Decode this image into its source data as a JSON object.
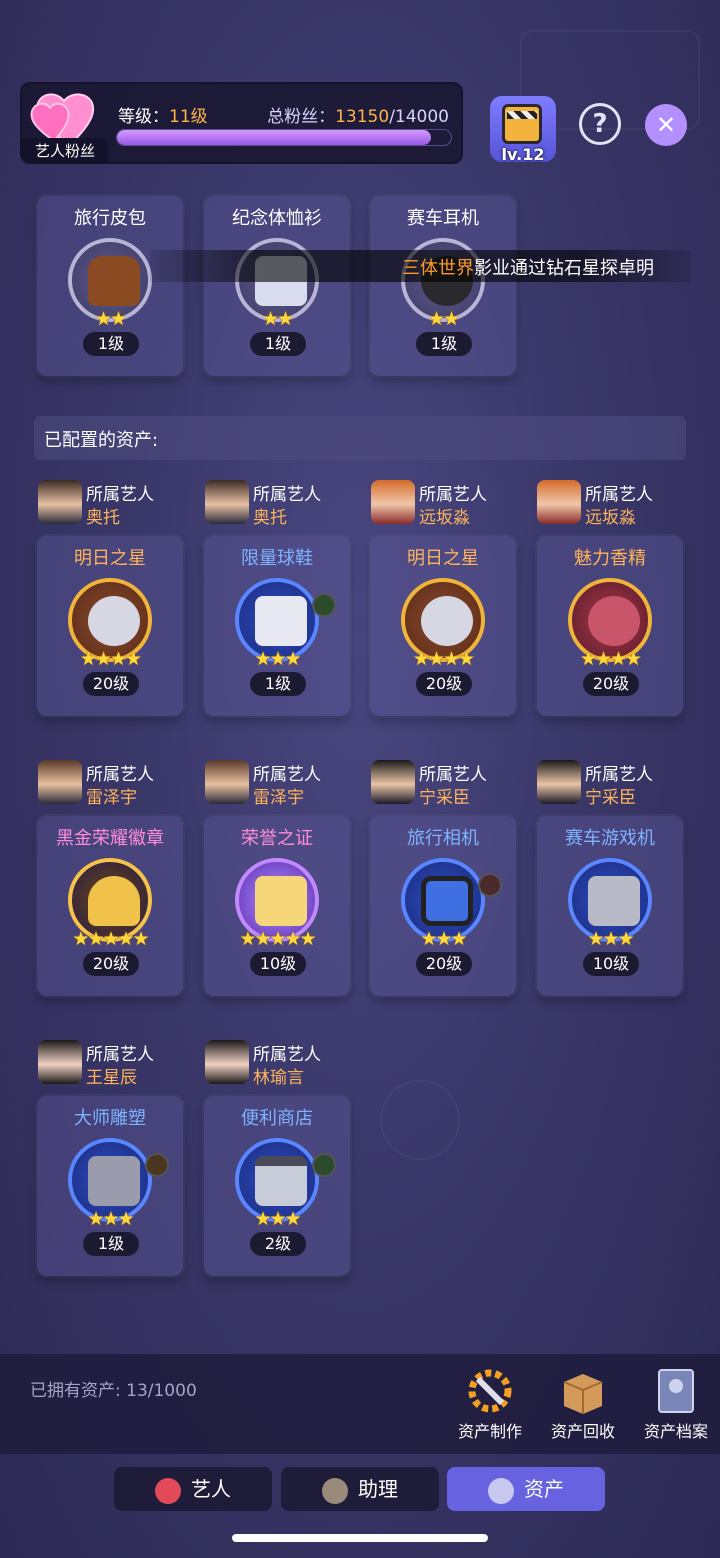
{
  "header": {
    "fans_tag": "艺人粉丝",
    "level_label": "等级：",
    "level_value": "11级",
    "fans_label": "总粉丝：",
    "fans_current": "13150",
    "fans_max": "/14000",
    "fans_progress": 0.939,
    "badge_level": "lv.12",
    "help_icon": "question-icon",
    "close_icon": "close-icon"
  },
  "unassigned": [
    {
      "title": "旅行皮包",
      "stars": "★★",
      "level": "1级"
    },
    {
      "title": "纪念体恤衫",
      "stars": "★★",
      "level": "1级"
    },
    {
      "title": "赛车耳机",
      "stars": "★★",
      "level": "1级"
    }
  ],
  "marquee": {
    "highlight": "三体世界",
    "text": "影业通过钻石星探卓明"
  },
  "section_title": "已配置的资产:",
  "owner_label": "所属艺人",
  "assets": [
    {
      "owner": "奥托",
      "title": "明日之星",
      "stars": "★★★★",
      "level": "20级",
      "color": "orange"
    },
    {
      "owner": "奥托",
      "title": "限量球鞋",
      "stars": "★★★",
      "level": "1级",
      "color": "blue"
    },
    {
      "owner": "远坂淼",
      "title": "明日之星",
      "stars": "★★★★",
      "level": "20级",
      "color": "orange"
    },
    {
      "owner": "远坂淼",
      "title": "魅力香精",
      "stars": "★★★★",
      "level": "20级",
      "color": "orange"
    },
    {
      "owner": "雷泽宇",
      "title": "黑金荣耀徽章",
      "stars": "★★★★★",
      "level": "20级",
      "color": "pink"
    },
    {
      "owner": "雷泽宇",
      "title": "荣誉之证",
      "stars": "★★★★★",
      "level": "10级",
      "color": "pink"
    },
    {
      "owner": "宁采臣",
      "title": "旅行相机",
      "stars": "★★★",
      "level": "20级",
      "color": "blue"
    },
    {
      "owner": "宁采臣",
      "title": "赛车游戏机",
      "stars": "★★★",
      "level": "10级",
      "color": "blue"
    },
    {
      "owner": "王星辰",
      "title": "大师雕塑",
      "stars": "★★★",
      "level": "1级",
      "color": "blue"
    },
    {
      "owner": "林瑜言",
      "title": "便利商店",
      "stars": "★★★",
      "level": "2级",
      "color": "blue"
    }
  ],
  "bottom": {
    "owned": "已拥有资产: 13/1000",
    "tools": [
      {
        "label": "资产制作",
        "icon": "wrench-gear-icon"
      },
      {
        "label": "资产回收",
        "icon": "box-icon"
      },
      {
        "label": "资产档案",
        "icon": "book-icon"
      }
    ]
  },
  "tabs": [
    {
      "label": "艺人",
      "icon": "artist-icon"
    },
    {
      "label": "助理",
      "icon": "assistant-icon"
    },
    {
      "label": "资产",
      "icon": "asset-icon"
    }
  ],
  "colors": {
    "accent": "#6762e0",
    "orange": "#ffb45a",
    "blue": "#7fb2ff",
    "pink": "#ff8cd8"
  }
}
